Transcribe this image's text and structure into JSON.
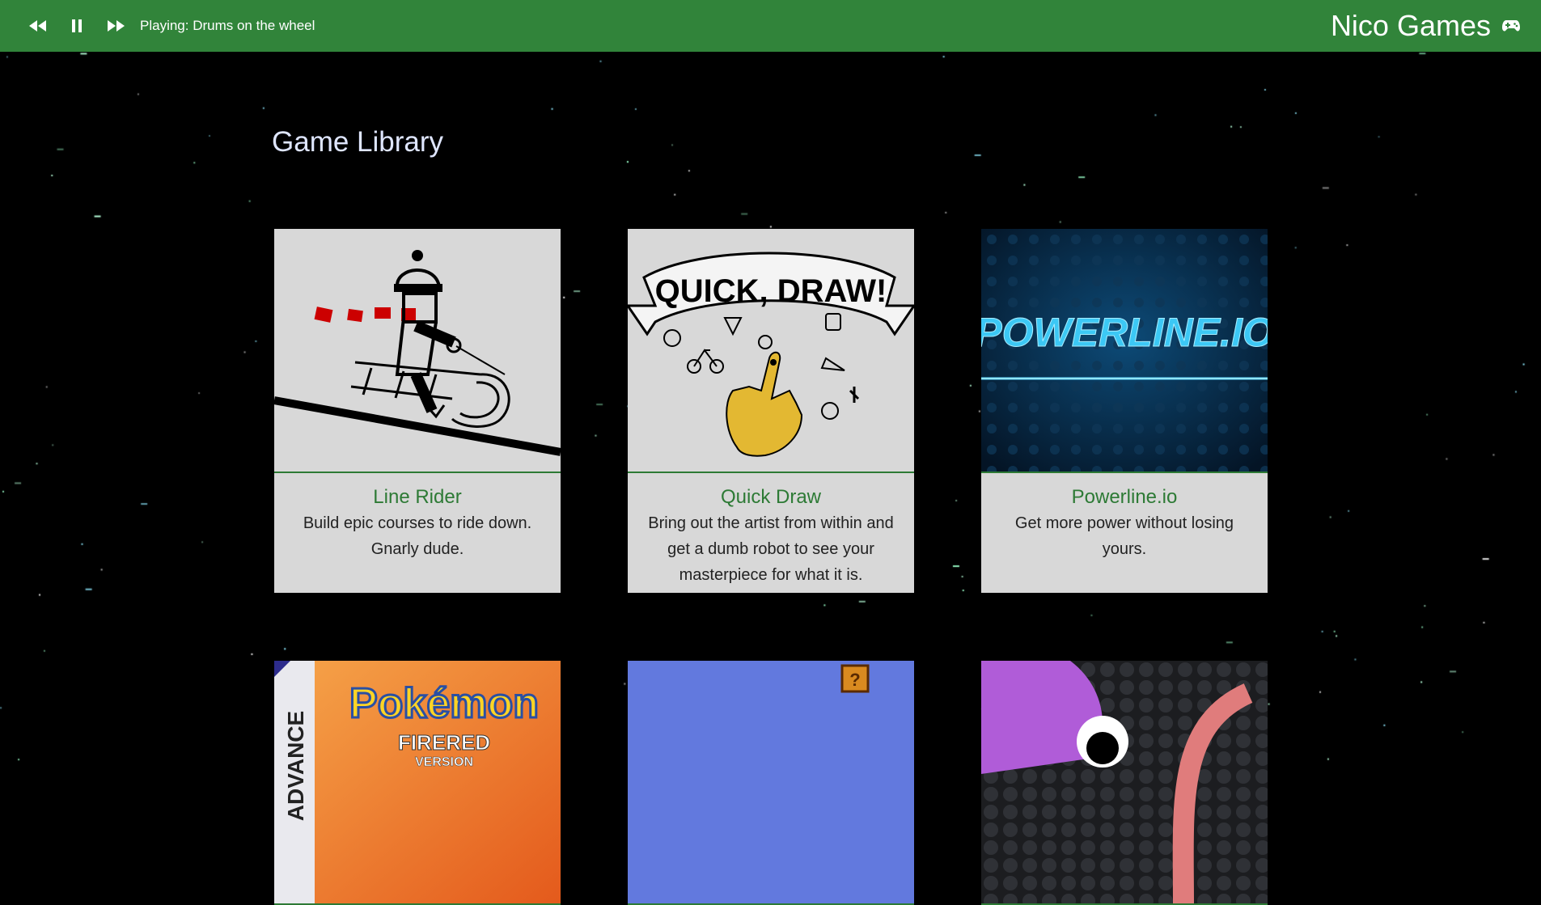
{
  "player": {
    "rewind_icon": "rewind-icon",
    "pause_icon": "pause-icon",
    "forward_icon": "fast-forward-icon",
    "now_playing": "Playing: Drums on the wheel"
  },
  "brand": {
    "title": "Nico Games",
    "icon": "gamepad-icon"
  },
  "library": {
    "title": "Game Library",
    "games": [
      {
        "name": "Line Rider",
        "description": "Build epic courses to ride down. Gnarly dude.",
        "thumb_text": ""
      },
      {
        "name": "Quick Draw",
        "description": "Bring out the artist from within and get a dumb robot to see your masterpiece for what it is.",
        "thumb_text": "QUICK, DRAW!"
      },
      {
        "name": "Powerline.io",
        "description": "Get more power without losing yours.",
        "thumb_text": "POWERLINE.IO"
      },
      {
        "thumb_text_1": "ADVANCE",
        "thumb_text_2": "Pokémon",
        "thumb_text_3": "FIRERED",
        "thumb_text_4": "VERSION"
      },
      {
        "thumb_text": "?"
      },
      {
        "thumb_text": ""
      }
    ]
  },
  "colors": {
    "topbar": "#31843a",
    "background": "#000000",
    "card": "#d8d8d8",
    "accent_green": "#2d7a35",
    "title": "#dfe6ff"
  }
}
